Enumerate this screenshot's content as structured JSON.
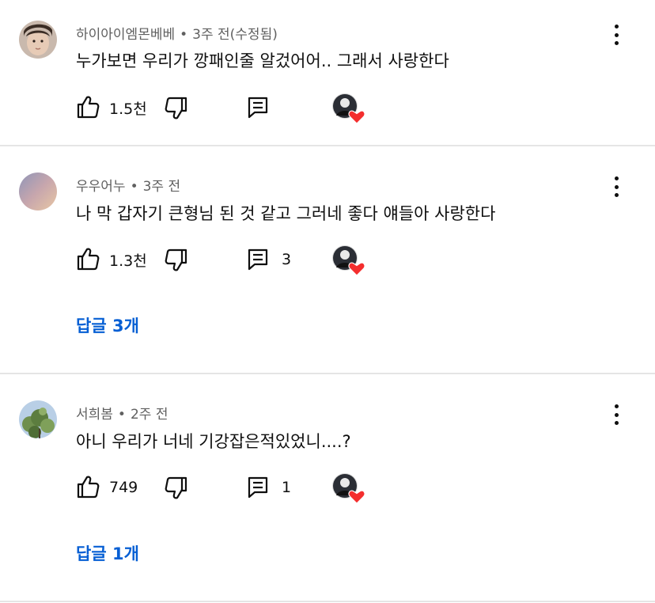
{
  "comments": [
    {
      "author": "하이아이엠몬베베",
      "time": "3주 전(수정됨)",
      "text": "누가보면 우리가 깡패인줄 알겄어어.. 그래서 사랑한다",
      "likes": "1.5천",
      "reply_count": "",
      "replies_link": ""
    },
    {
      "author": "우우어누",
      "time": "3주 전",
      "text": "나 막 갑자기 큰형님 된 것 같고 그러네 좋다 얘들아 사랑한다",
      "likes": "1.3천",
      "reply_count": "3",
      "replies_link": "답글 3개"
    },
    {
      "author": "서희봄",
      "time": "2주 전",
      "text": "아니 우리가 너네 기강잡은적있었니....?",
      "likes": "749",
      "reply_count": "1",
      "replies_link": "답글 1개"
    }
  ],
  "separator": "•",
  "colors": {
    "meta": "#606060",
    "text": "#0f0f0f",
    "link": "#065fd4",
    "divider": "#e5e5e5",
    "heart": "#f42e2e"
  },
  "icons": [
    "thumb-up-icon",
    "thumb-down-icon",
    "reply-icon",
    "heart-icon",
    "more-vert-icon"
  ]
}
